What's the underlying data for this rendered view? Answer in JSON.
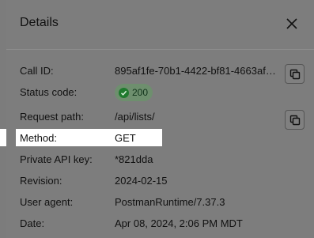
{
  "header": {
    "title": "Details"
  },
  "rows": {
    "call_id": {
      "label": "Call ID:",
      "value": "895af1fe-70b1-4422-bf81-4663af7..."
    },
    "status_code": {
      "label": "Status code:",
      "value": "200"
    },
    "request_path": {
      "label": "Request path:",
      "value": "/api/lists/"
    },
    "method": {
      "label": "Method:",
      "value": "GET"
    },
    "private_api_key": {
      "label": "Private API key:",
      "value": "*821dda"
    },
    "revision": {
      "label": "Revision:",
      "value": "2024-02-15"
    },
    "user_agent": {
      "label": "User agent:",
      "value": "PostmanRuntime/7.37.3"
    },
    "date": {
      "label": "Date:",
      "value": "Apr 08, 2024, 2:06 PM MDT"
    }
  },
  "icons": {
    "close": "close-icon",
    "copy": "copy-icon",
    "status": "check-circle-icon"
  },
  "colors": {
    "status_success": "#1f7a2e",
    "highlight": "#ffffff"
  }
}
